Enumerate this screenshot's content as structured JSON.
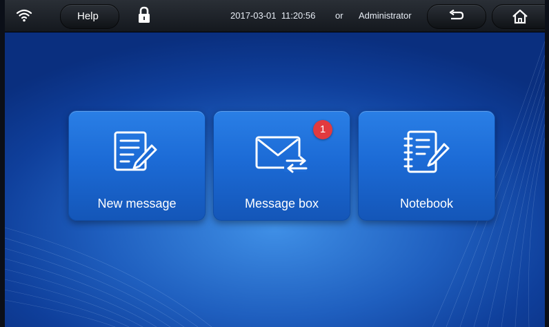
{
  "status_bar": {
    "help_label": "Help",
    "datetime": "2017-03-01  11:20:56",
    "separator": "or",
    "user": "Administrator",
    "icons": {
      "wifi": "wifi-icon",
      "lock": "lock-icon",
      "back": "back-icon",
      "home": "home-icon"
    }
  },
  "tiles": [
    {
      "label": "New message",
      "icon": "compose-icon"
    },
    {
      "label": "Message box",
      "icon": "envelope-icon",
      "badge": "1"
    },
    {
      "label": "Notebook",
      "icon": "notebook-icon"
    }
  ],
  "colors": {
    "tile": "#1c6bd6",
    "background": "#1f5fbf",
    "badge": "#e23a3f",
    "topbar": "#1d2127"
  }
}
